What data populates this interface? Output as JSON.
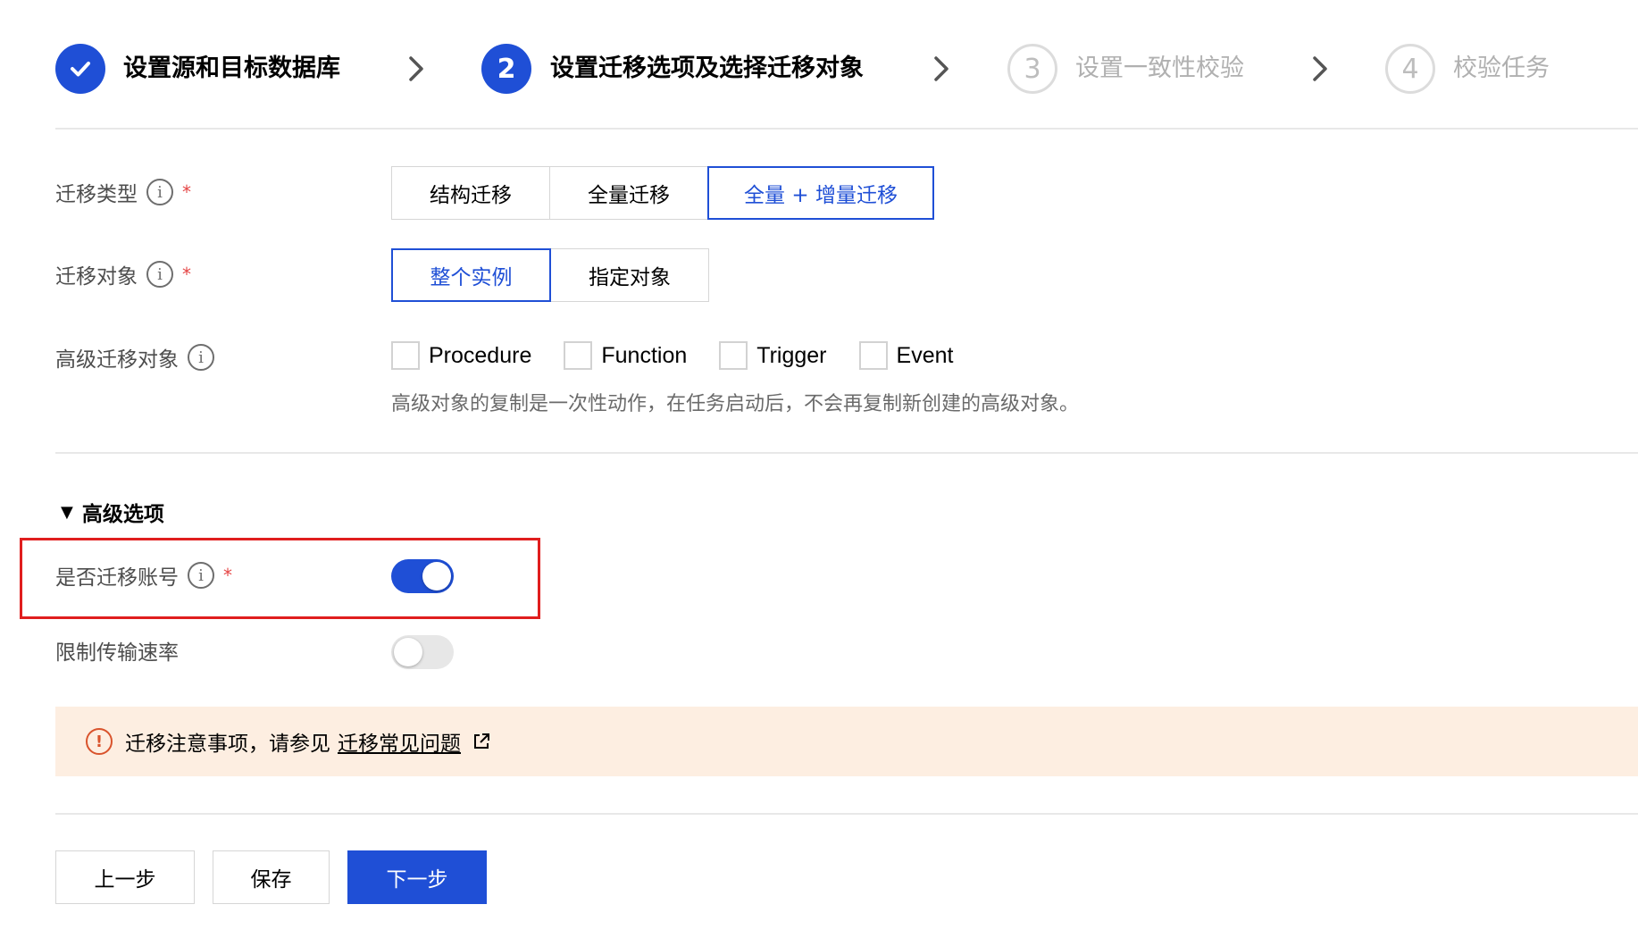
{
  "steps": [
    {
      "number": "",
      "label": "设置源和目标数据库",
      "state": "done"
    },
    {
      "number": "2",
      "label": "设置迁移选项及选择迁移对象",
      "state": "active"
    },
    {
      "number": "3",
      "label": "设置一致性校验",
      "state": "todo"
    },
    {
      "number": "4",
      "label": "校验任务",
      "state": "todo"
    }
  ],
  "form": {
    "migration_type": {
      "label": "迁移类型",
      "required_mark": "*",
      "options": [
        "结构迁移",
        "全量迁移",
        "全量 + 增量迁移"
      ],
      "selected": "全量 + 增量迁移"
    },
    "migration_object": {
      "label": "迁移对象",
      "required_mark": "*",
      "options": [
        "整个实例",
        "指定对象"
      ],
      "selected": "整个实例"
    },
    "advanced_objects": {
      "label": "高级迁移对象",
      "options": [
        "Procedure",
        "Function",
        "Trigger",
        "Event"
      ],
      "hint": "高级对象的复制是一次性动作，在任务启动后，不会再复制新创建的高级对象。"
    }
  },
  "advanced_section": {
    "title": "高级选项",
    "caret": "▼",
    "migrate_accounts": {
      "label": "是否迁移账号",
      "required_mark": "*",
      "enabled": true
    },
    "limit_rate": {
      "label": "限制传输速率",
      "enabled": false
    }
  },
  "notice": {
    "icon": "!",
    "text": "迁移注意事项，请参见",
    "link_text": "迁移常见问题"
  },
  "buttons": {
    "prev": "上一步",
    "save": "保存",
    "next": "下一步"
  },
  "colors": {
    "primary": "#1f4fd6",
    "required": "#e54545",
    "highlight": "#e01e1e",
    "notice_bg": "#fdeee1",
    "warning": "#d9532c"
  },
  "icons": {
    "info": "i"
  }
}
